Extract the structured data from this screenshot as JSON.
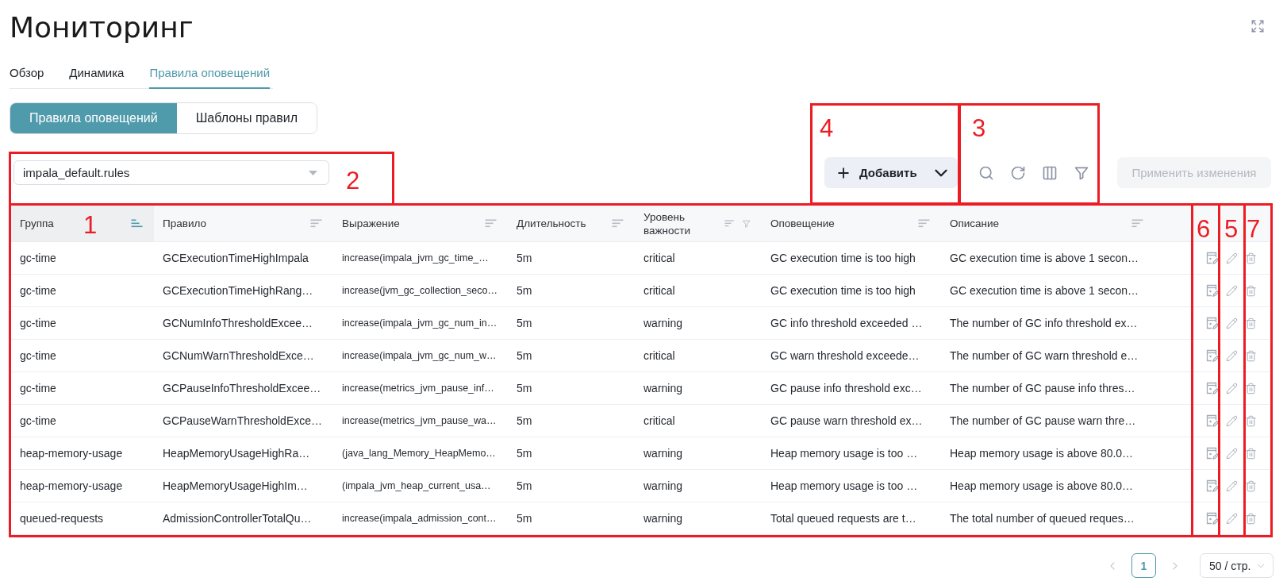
{
  "page": {
    "title": "Мониторинг"
  },
  "tabs": [
    {
      "label": "Обзор",
      "selected": false
    },
    {
      "label": "Динамика",
      "selected": false
    },
    {
      "label": "Правила оповещений",
      "selected": true
    }
  ],
  "view_switch": [
    {
      "label": "Правила оповещений",
      "selected": true
    },
    {
      "label": "Шаблоны правил",
      "selected": false
    }
  ],
  "rule_file_select": {
    "value": "impala_default.rules"
  },
  "toolbar": {
    "add_button": "Добавить",
    "apply_button": {
      "label": "Применить изменения",
      "disabled": true
    }
  },
  "table": {
    "columns": [
      {
        "label": "Группа",
        "sorted": true,
        "filterable": false
      },
      {
        "label": "Правило",
        "sorted": false,
        "filterable": false
      },
      {
        "label": "Выражение",
        "sorted": false,
        "filterable": false
      },
      {
        "label": "Длительность",
        "sorted": false,
        "filterable": false
      },
      {
        "label": "Уровень важности",
        "sorted": false,
        "filterable": true
      },
      {
        "label": "Оповещение",
        "sorted": false,
        "filterable": false
      },
      {
        "label": "Описание",
        "sorted": false,
        "filterable": false
      }
    ],
    "rows": [
      [
        "gc-time",
        "GCExecutionTimeHighImpala",
        "increase(impala_jvm_gc_time_…",
        "5m",
        "critical",
        "GC execution time is too high",
        "GC execution time is above 1 secon…"
      ],
      [
        "gc-time",
        "GCExecutionTimeHighRang…",
        "increase(jvm_gc_collection_seco…",
        "5m",
        "critical",
        "GC execution time is too high",
        "GC execution time is above 1 secon…"
      ],
      [
        "gc-time",
        "GCNumInfoThresholdExcee…",
        "increase(impala_jvm_gc_num_in…",
        "5m",
        "warning",
        "GC info threshold exceeded …",
        "The number of GC info threshold ex…"
      ],
      [
        "gc-time",
        "GCNumWarnThresholdExce…",
        "increase(impala_jvm_gc_num_w…",
        "5m",
        "critical",
        "GC warn threshold exceede…",
        "The number of GC warn threshold e…"
      ],
      [
        "gc-time",
        "GCPauseInfoThresholdExcee…",
        "increase(metrics_jvm_pause_inf…",
        "5m",
        "warning",
        "GC pause info threshold exc…",
        "The number of GC pause info thres…"
      ],
      [
        "gc-time",
        "GCPauseWarnThresholdExce…",
        "increase(metrics_jvm_pause_wa…",
        "5m",
        "critical",
        "GC pause warn threshold ex…",
        "The number of GC pause warn thre…"
      ],
      [
        "heap-memory-usage",
        "HeapMemoryUsageHighRa…",
        "(java_lang_Memory_HeapMemo…",
        "5m",
        "warning",
        "Heap memory usage is too …",
        "Heap memory usage is above 80.0…"
      ],
      [
        "heap-memory-usage",
        "HeapMemoryUsageHighIm…",
        "(impala_jvm_heap_current_usa…",
        "5m",
        "warning",
        "Heap memory usage is too …",
        "Heap memory usage is above 80.0…"
      ],
      [
        "queued-requests",
        "AdmissionControllerTotalQu…",
        "increase(impala_admission_cont…",
        "5m",
        "warning",
        "Total queued requests are t…",
        "The total number of queued reques…"
      ]
    ]
  },
  "pagination": {
    "prev": {
      "disabled": true
    },
    "pages": [
      {
        "label": "1",
        "selected": true
      }
    ],
    "next": {
      "disabled": true
    },
    "page_size": "50 / стр."
  },
  "annotations": [
    {
      "label": "4"
    },
    {
      "label": "3"
    },
    {
      "label": "2"
    },
    {
      "label": "1"
    },
    {
      "label": "6"
    },
    {
      "label": "5"
    },
    {
      "label": "7"
    }
  ]
}
